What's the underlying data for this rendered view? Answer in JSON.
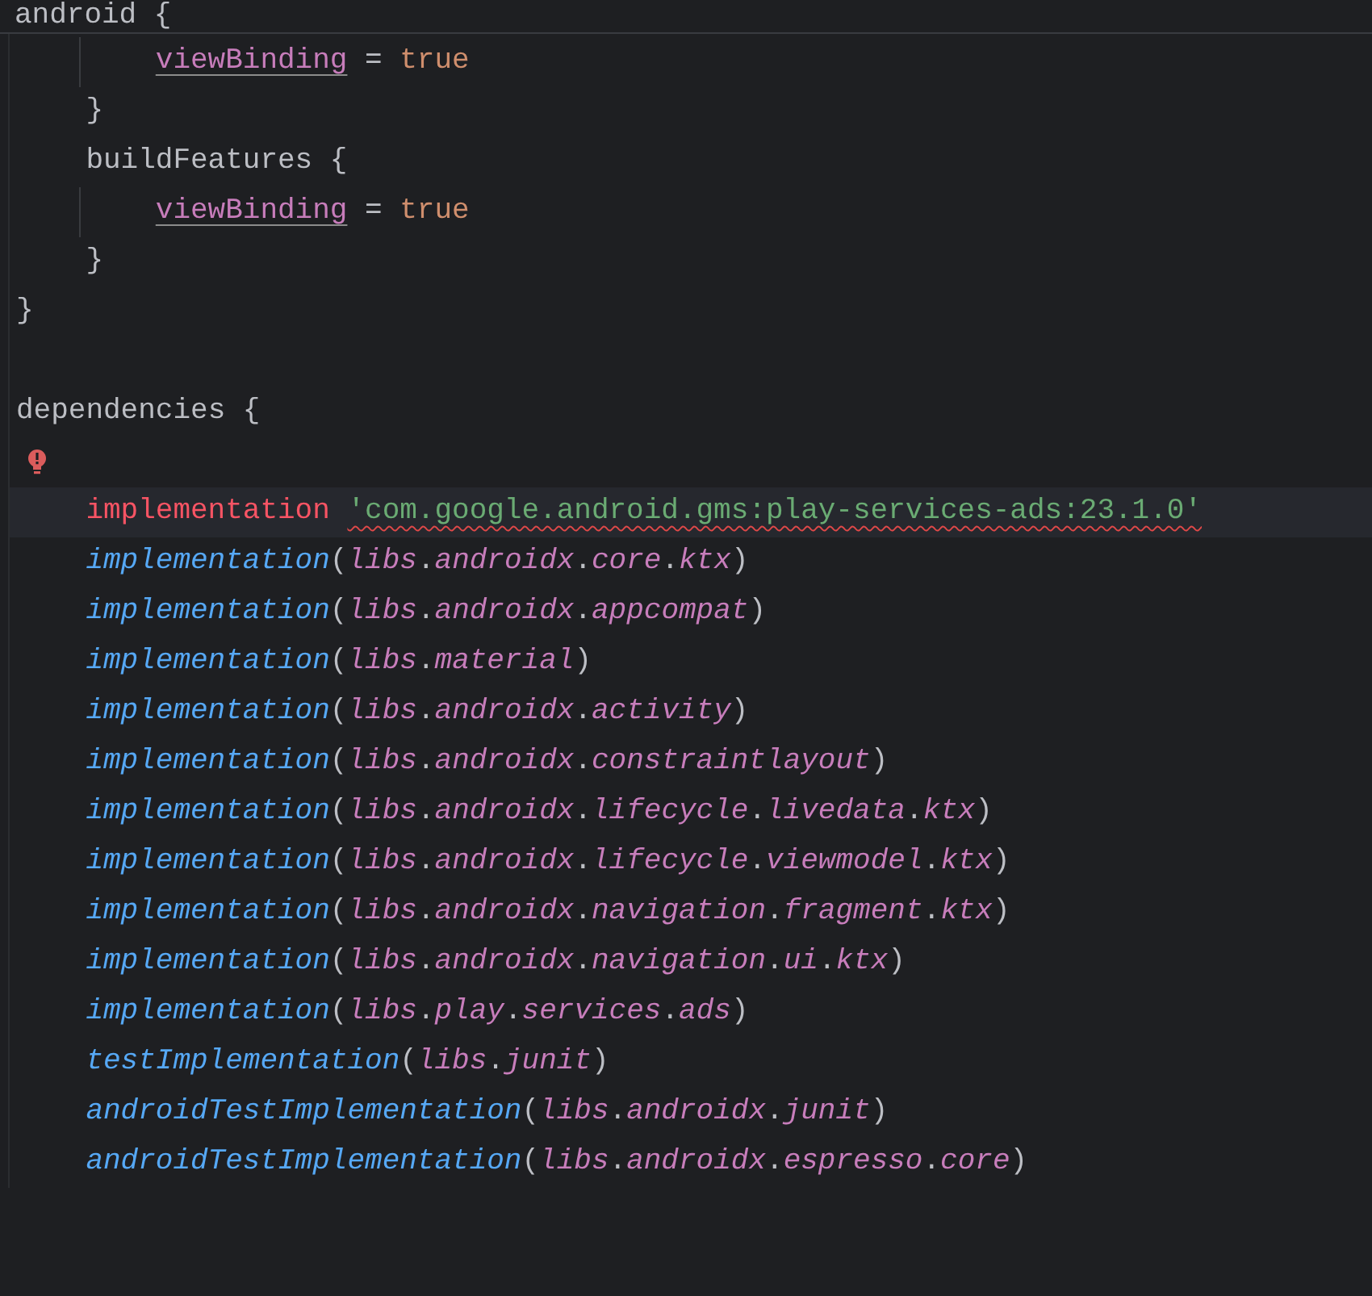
{
  "sticky_header": {
    "text": "android {"
  },
  "lines": [
    {
      "children": [
        {
          "children": [
            {
              "kind": "code",
              "current": false,
              "tokens": [
                {
                  "kind": "property",
                  "text": "viewBinding"
                },
                {
                  "kind": "plain",
                  "text": " = "
                },
                {
                  "kind": "keyword",
                  "text": "true"
                }
              ]
            }
          ]
        },
        {
          "kind": "code",
          "current": false,
          "tokens": [
            {
              "kind": "plain",
              "text": "}"
            }
          ]
        },
        {
          "kind": "code",
          "current": false,
          "tokens": [
            {
              "kind": "plain",
              "text": "buildFeatures {"
            }
          ],
          "children": [
            {
              "kind": "code",
              "current": false,
              "tokens": [
                {
                  "kind": "property",
                  "text": "viewBinding"
                },
                {
                  "kind": "plain",
                  "text": " = "
                },
                {
                  "kind": "keyword",
                  "text": "true"
                }
              ]
            }
          ]
        },
        {
          "kind": "code",
          "current": false,
          "tokens": [
            {
              "kind": "plain",
              "text": "}"
            }
          ]
        }
      ]
    },
    {
      "kind": "code",
      "current": false,
      "tokens": [
        {
          "kind": "plain",
          "text": "}"
        }
      ]
    },
    {
      "kind": "code",
      "current": false
    },
    {
      "kind": "code",
      "current": false,
      "tokens": [
        {
          "kind": "plain",
          "text": "dependencies {"
        }
      ],
      "children": [
        {
          "kind": "hint",
          "current": false
        },
        {
          "kind": "code",
          "current": true,
          "tokens": [
            {
              "kind": "error",
              "text": "implementation "
            },
            {
              "kind": "invalid",
              "text": "'com.google.android.gms:play-services-ads:23.1.0'"
            }
          ]
        },
        {
          "kind": "code",
          "current": false,
          "tokens": [
            {
              "kind": "call",
              "text": "implementation"
            },
            {
              "kind": "plain",
              "text": "("
            },
            {
              "kind": "member",
              "text": "libs"
            },
            {
              "kind": "plain",
              "text": "."
            },
            {
              "kind": "member",
              "text": "androidx"
            },
            {
              "kind": "plain",
              "text": "."
            },
            {
              "kind": "member",
              "text": "core"
            },
            {
              "kind": "plain",
              "text": "."
            },
            {
              "kind": "member",
              "text": "ktx"
            },
            {
              "kind": "plain",
              "text": ")"
            }
          ]
        },
        {
          "kind": "code",
          "current": false,
          "tokens": [
            {
              "kind": "call",
              "text": "implementation"
            },
            {
              "kind": "plain",
              "text": "("
            },
            {
              "kind": "member",
              "text": "libs"
            },
            {
              "kind": "plain",
              "text": "."
            },
            {
              "kind": "member",
              "text": "androidx"
            },
            {
              "kind": "plain",
              "text": "."
            },
            {
              "kind": "member",
              "text": "appcompat"
            },
            {
              "kind": "plain",
              "text": ")"
            }
          ]
        },
        {
          "kind": "code",
          "current": false,
          "tokens": [
            {
              "kind": "call",
              "text": "implementation"
            },
            {
              "kind": "plain",
              "text": "("
            },
            {
              "kind": "member",
              "text": "libs"
            },
            {
              "kind": "plain",
              "text": "."
            },
            {
              "kind": "member",
              "text": "material"
            },
            {
              "kind": "plain",
              "text": ")"
            }
          ]
        },
        {
          "kind": "code",
          "current": false,
          "tokens": [
            {
              "kind": "call",
              "text": "implementation"
            },
            {
              "kind": "plain",
              "text": "("
            },
            {
              "kind": "member",
              "text": "libs"
            },
            {
              "kind": "plain",
              "text": "."
            },
            {
              "kind": "member",
              "text": "androidx"
            },
            {
              "kind": "plain",
              "text": "."
            },
            {
              "kind": "member",
              "text": "activity"
            },
            {
              "kind": "plain",
              "text": ")"
            }
          ]
        },
        {
          "kind": "code",
          "current": false,
          "tokens": [
            {
              "kind": "call",
              "text": "implementation"
            },
            {
              "kind": "plain",
              "text": "("
            },
            {
              "kind": "member",
              "text": "libs"
            },
            {
              "kind": "plain",
              "text": "."
            },
            {
              "kind": "member",
              "text": "androidx"
            },
            {
              "kind": "plain",
              "text": "."
            },
            {
              "kind": "member",
              "text": "constraintlayout"
            },
            {
              "kind": "plain",
              "text": ")"
            }
          ]
        },
        {
          "kind": "code",
          "current": false,
          "tokens": [
            {
              "kind": "call",
              "text": "implementation"
            },
            {
              "kind": "plain",
              "text": "("
            },
            {
              "kind": "member",
              "text": "libs"
            },
            {
              "kind": "plain",
              "text": "."
            },
            {
              "kind": "member",
              "text": "androidx"
            },
            {
              "kind": "plain",
              "text": "."
            },
            {
              "kind": "member",
              "text": "lifecycle"
            },
            {
              "kind": "plain",
              "text": "."
            },
            {
              "kind": "member",
              "text": "livedata"
            },
            {
              "kind": "plain",
              "text": "."
            },
            {
              "kind": "member",
              "text": "ktx"
            },
            {
              "kind": "plain",
              "text": ")"
            }
          ]
        },
        {
          "kind": "code",
          "current": false,
          "tokens": [
            {
              "kind": "call",
              "text": "implementation"
            },
            {
              "kind": "plain",
              "text": "("
            },
            {
              "kind": "member",
              "text": "libs"
            },
            {
              "kind": "plain",
              "text": "."
            },
            {
              "kind": "member",
              "text": "androidx"
            },
            {
              "kind": "plain",
              "text": "."
            },
            {
              "kind": "member",
              "text": "lifecycle"
            },
            {
              "kind": "plain",
              "text": "."
            },
            {
              "kind": "member",
              "text": "viewmodel"
            },
            {
              "kind": "plain",
              "text": "."
            },
            {
              "kind": "member",
              "text": "ktx"
            },
            {
              "kind": "plain",
              "text": ")"
            }
          ]
        },
        {
          "kind": "code",
          "current": false,
          "tokens": [
            {
              "kind": "call",
              "text": "implementation"
            },
            {
              "kind": "plain",
              "text": "("
            },
            {
              "kind": "member",
              "text": "libs"
            },
            {
              "kind": "plain",
              "text": "."
            },
            {
              "kind": "member",
              "text": "androidx"
            },
            {
              "kind": "plain",
              "text": "."
            },
            {
              "kind": "member",
              "text": "navigation"
            },
            {
              "kind": "plain",
              "text": "."
            },
            {
              "kind": "member",
              "text": "fragment"
            },
            {
              "kind": "plain",
              "text": "."
            },
            {
              "kind": "member",
              "text": "ktx"
            },
            {
              "kind": "plain",
              "text": ")"
            }
          ]
        },
        {
          "kind": "code",
          "current": false,
          "tokens": [
            {
              "kind": "call",
              "text": "implementation"
            },
            {
              "kind": "plain",
              "text": "("
            },
            {
              "kind": "member",
              "text": "libs"
            },
            {
              "kind": "plain",
              "text": "."
            },
            {
              "kind": "member",
              "text": "androidx"
            },
            {
              "kind": "plain",
              "text": "."
            },
            {
              "kind": "member",
              "text": "navigation"
            },
            {
              "kind": "plain",
              "text": "."
            },
            {
              "kind": "member",
              "text": "ui"
            },
            {
              "kind": "plain",
              "text": "."
            },
            {
              "kind": "member",
              "text": "ktx"
            },
            {
              "kind": "plain",
              "text": ")"
            }
          ]
        },
        {
          "kind": "code",
          "current": false,
          "tokens": [
            {
              "kind": "call",
              "text": "implementation"
            },
            {
              "kind": "plain",
              "text": "("
            },
            {
              "kind": "member",
              "text": "libs"
            },
            {
              "kind": "plain",
              "text": "."
            },
            {
              "kind": "member",
              "text": "play"
            },
            {
              "kind": "plain",
              "text": "."
            },
            {
              "kind": "member",
              "text": "services"
            },
            {
              "kind": "plain",
              "text": "."
            },
            {
              "kind": "member",
              "text": "ads"
            },
            {
              "kind": "plain",
              "text": ")"
            }
          ]
        },
        {
          "kind": "code",
          "current": false,
          "tokens": [
            {
              "kind": "call",
              "text": "testImplementation"
            },
            {
              "kind": "plain",
              "text": "("
            },
            {
              "kind": "member",
              "text": "libs"
            },
            {
              "kind": "plain",
              "text": "."
            },
            {
              "kind": "member",
              "text": "junit"
            },
            {
              "kind": "plain",
              "text": ")"
            }
          ]
        },
        {
          "kind": "code",
          "current": false,
          "tokens": [
            {
              "kind": "call",
              "text": "androidTestImplementation"
            },
            {
              "kind": "plain",
              "text": "("
            },
            {
              "kind": "member",
              "text": "libs"
            },
            {
              "kind": "plain",
              "text": "."
            },
            {
              "kind": "member",
              "text": "androidx"
            },
            {
              "kind": "plain",
              "text": "."
            },
            {
              "kind": "member",
              "text": "junit"
            },
            {
              "kind": "plain",
              "text": ")"
            }
          ]
        },
        {
          "kind": "code",
          "current": false,
          "tokens": [
            {
              "kind": "call",
              "text": "androidTestImplementation"
            },
            {
              "kind": "plain",
              "text": "("
            },
            {
              "kind": "member",
              "text": "libs"
            },
            {
              "kind": "plain",
              "text": "."
            },
            {
              "kind": "member",
              "text": "androidx"
            },
            {
              "kind": "plain",
              "text": "."
            },
            {
              "kind": "member",
              "text": "espresso"
            },
            {
              "kind": "plain",
              "text": "."
            },
            {
              "kind": "member",
              "text": "core"
            },
            {
              "kind": "plain",
              "text": ")"
            }
          ]
        }
      ]
    }
  ]
}
